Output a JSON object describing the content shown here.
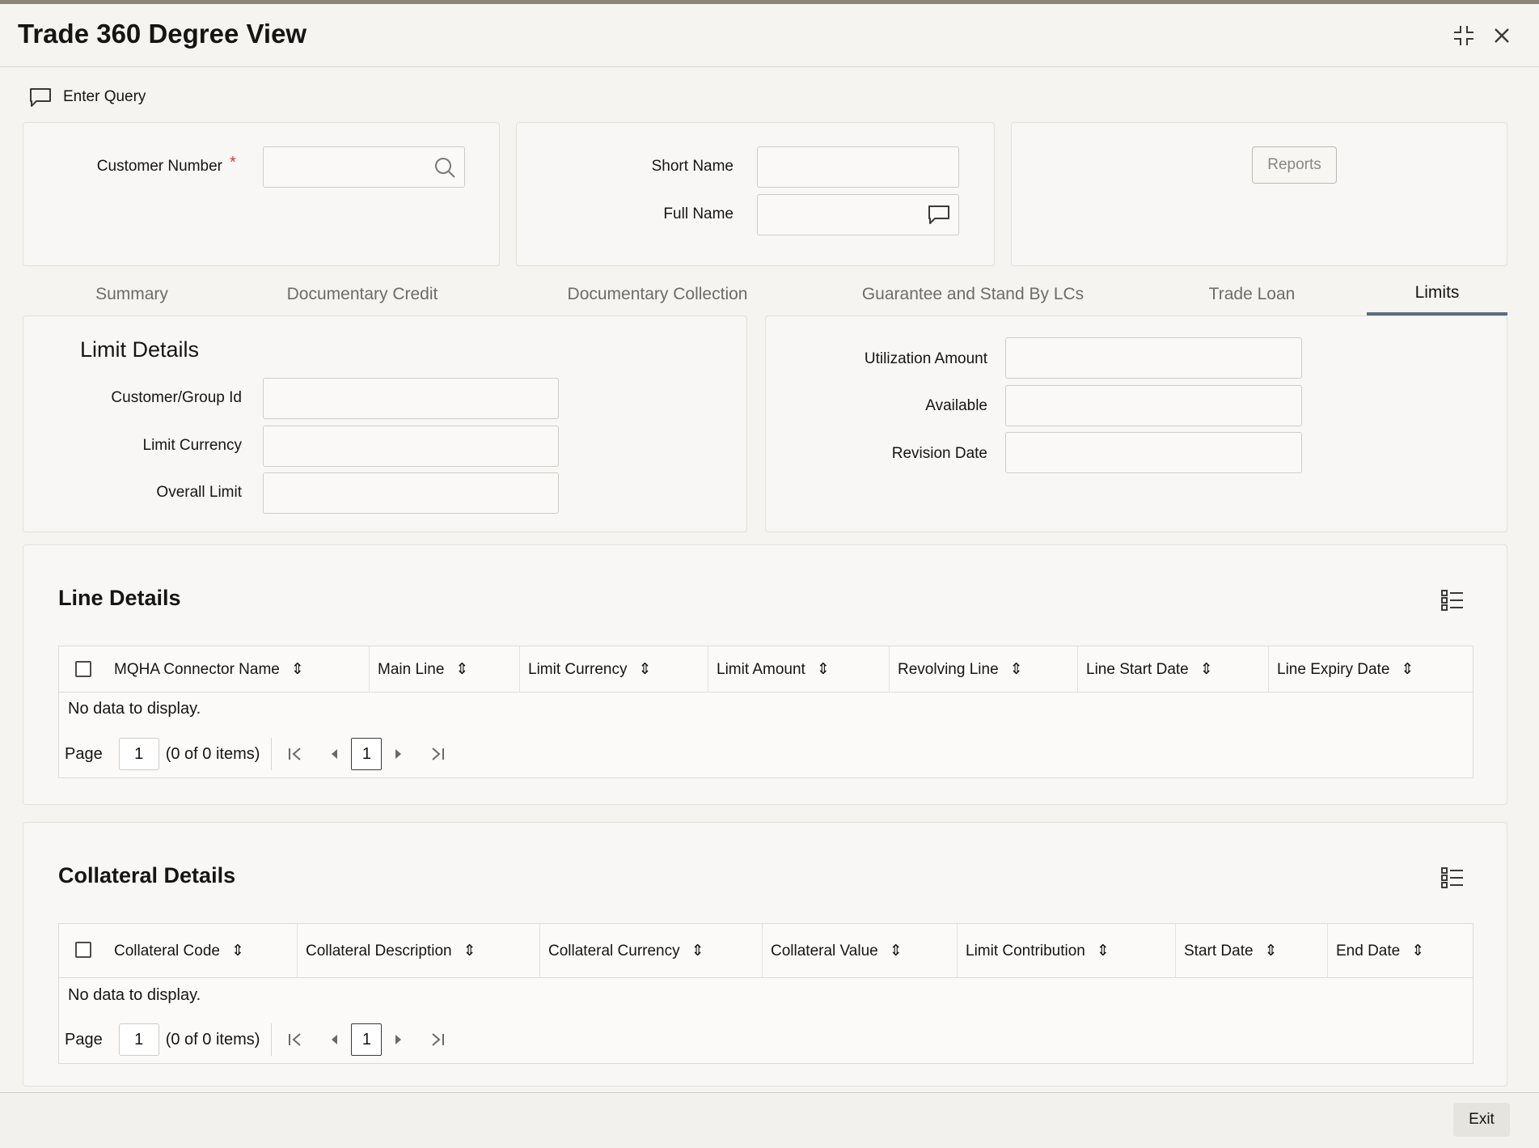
{
  "window": {
    "title": "Trade 360 Degree View"
  },
  "toolbar": {
    "enter_query_label": "Enter Query"
  },
  "header_form": {
    "customer_number_label": "Customer Number",
    "required_marker": "*",
    "customer_number_value": "",
    "short_name_label": "Short Name",
    "short_name_value": "",
    "full_name_label": "Full Name",
    "full_name_value": "",
    "reports_label": "Reports"
  },
  "tabs": [
    {
      "label": "Summary",
      "active": false
    },
    {
      "label": "Documentary Credit",
      "active": false
    },
    {
      "label": "Documentary Collection",
      "active": false
    },
    {
      "label": "Guarantee and Stand By LCs",
      "active": false
    },
    {
      "label": "Trade Loan",
      "active": false
    },
    {
      "label": "Limits",
      "active": true
    }
  ],
  "limit_details": {
    "title": "Limit Details",
    "customer_group_id_label": "Customer/Group Id",
    "limit_currency_label": "Limit Currency",
    "overall_limit_label": "Overall Limit",
    "utilization_amount_label": "Utilization Amount",
    "available_label": "Available",
    "revision_date_label": "Revision Date"
  },
  "line_details": {
    "title": "Line Details",
    "columns": [
      "MQHA Connector Name",
      "Main Line",
      "Limit Currency",
      "Limit Amount",
      "Revolving Line",
      "Line Start Date",
      "Line Expiry Date"
    ],
    "empty_text": "No data to display.",
    "pager": {
      "page_label": "Page",
      "page_value": "1",
      "items_text": "(0 of 0 items)",
      "current_page": "1"
    }
  },
  "collateral_details": {
    "title": "Collateral Details",
    "columns": [
      "Collateral Code",
      "Collateral Description",
      "Collateral Currency",
      "Collateral Value",
      "Limit Contribution",
      "Start Date",
      "End Date"
    ],
    "empty_text": "No data to display.",
    "pager": {
      "page_label": "Page",
      "page_value": "1",
      "items_text": "(0 of 0 items)",
      "current_page": "1"
    }
  },
  "footer": {
    "exit_label": "Exit"
  }
}
